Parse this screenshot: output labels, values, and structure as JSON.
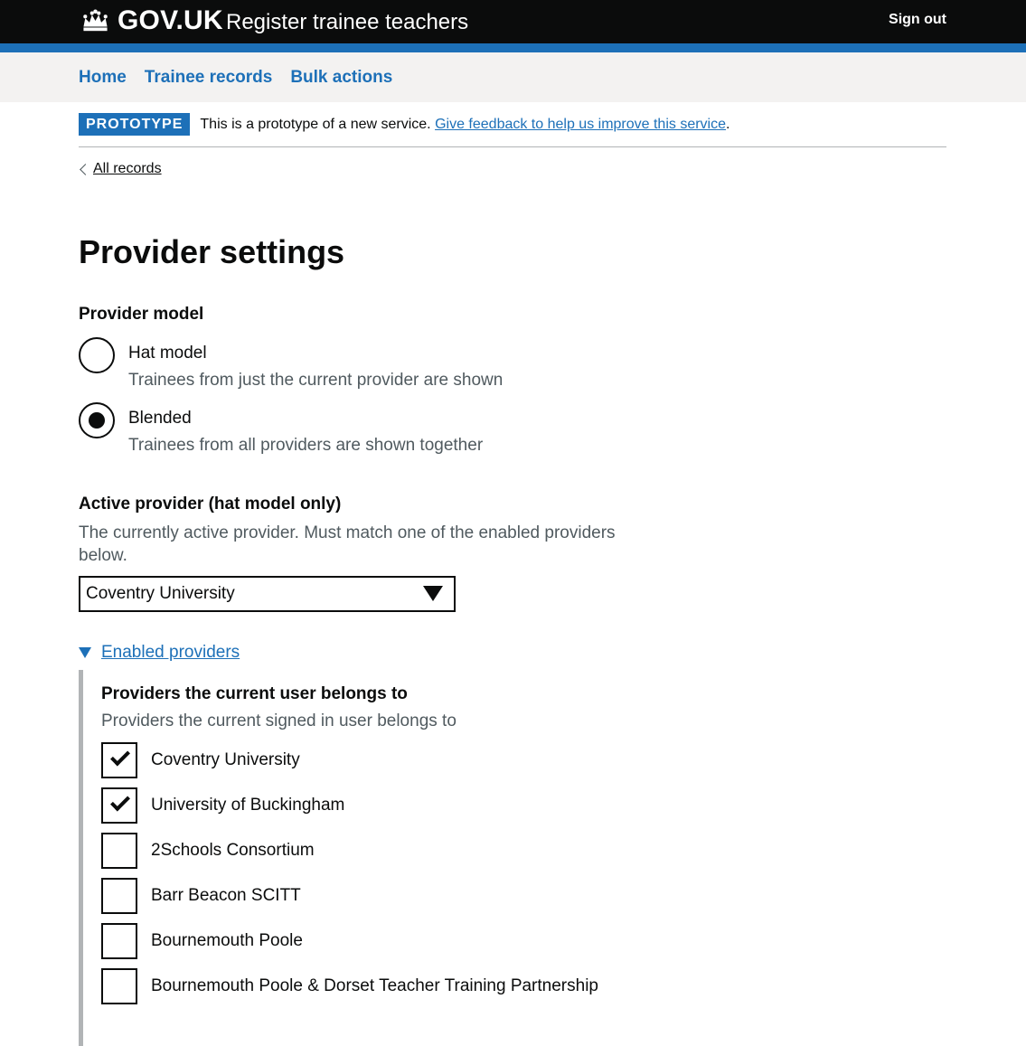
{
  "header": {
    "logo_text": "GOV.UK",
    "service_name": "Register trainee teachers",
    "sign_out": "Sign out"
  },
  "nav": {
    "items": [
      {
        "label": "Home"
      },
      {
        "label": "Trainee records"
      },
      {
        "label": "Bulk actions"
      }
    ]
  },
  "phase_banner": {
    "tag": "PROTOTYPE",
    "text": "This is a prototype of a new service.",
    "link": "Give feedback to help us improve this service",
    "suffix": "."
  },
  "back_link": "All records",
  "page_title": "Provider settings",
  "provider_model": {
    "legend": "Provider model",
    "options": [
      {
        "label": "Hat model",
        "hint": "Trainees from just the current provider are shown",
        "selected": false
      },
      {
        "label": "Blended",
        "hint": "Trainees from all providers are shown together",
        "selected": true
      }
    ]
  },
  "active_provider": {
    "label": "Active provider (hat model only)",
    "hint": "The currently active provider. Must match one of the enabled providers below.",
    "selected_value": "Coventry University"
  },
  "enabled_providers": {
    "summary": "Enabled providers",
    "group_label": "Providers the current user belongs to",
    "group_hint": "Providers the current signed in user belongs to",
    "items": [
      {
        "label": "Coventry University",
        "checked": true
      },
      {
        "label": "University of Buckingham",
        "checked": true
      },
      {
        "label": "2Schools Consortium",
        "checked": false
      },
      {
        "label": "Barr Beacon SCITT",
        "checked": false
      },
      {
        "label": "Bournemouth Poole",
        "checked": false
      },
      {
        "label": "Bournemouth Poole & Dorset Teacher Training Partnership",
        "checked": false
      }
    ]
  },
  "colors": {
    "brand_blue": "#1d70b8",
    "header_black": "#0b0c0c",
    "nav_bg": "#f3f2f1",
    "hint_grey": "#505a5f",
    "border_grey": "#b1b4b6"
  }
}
